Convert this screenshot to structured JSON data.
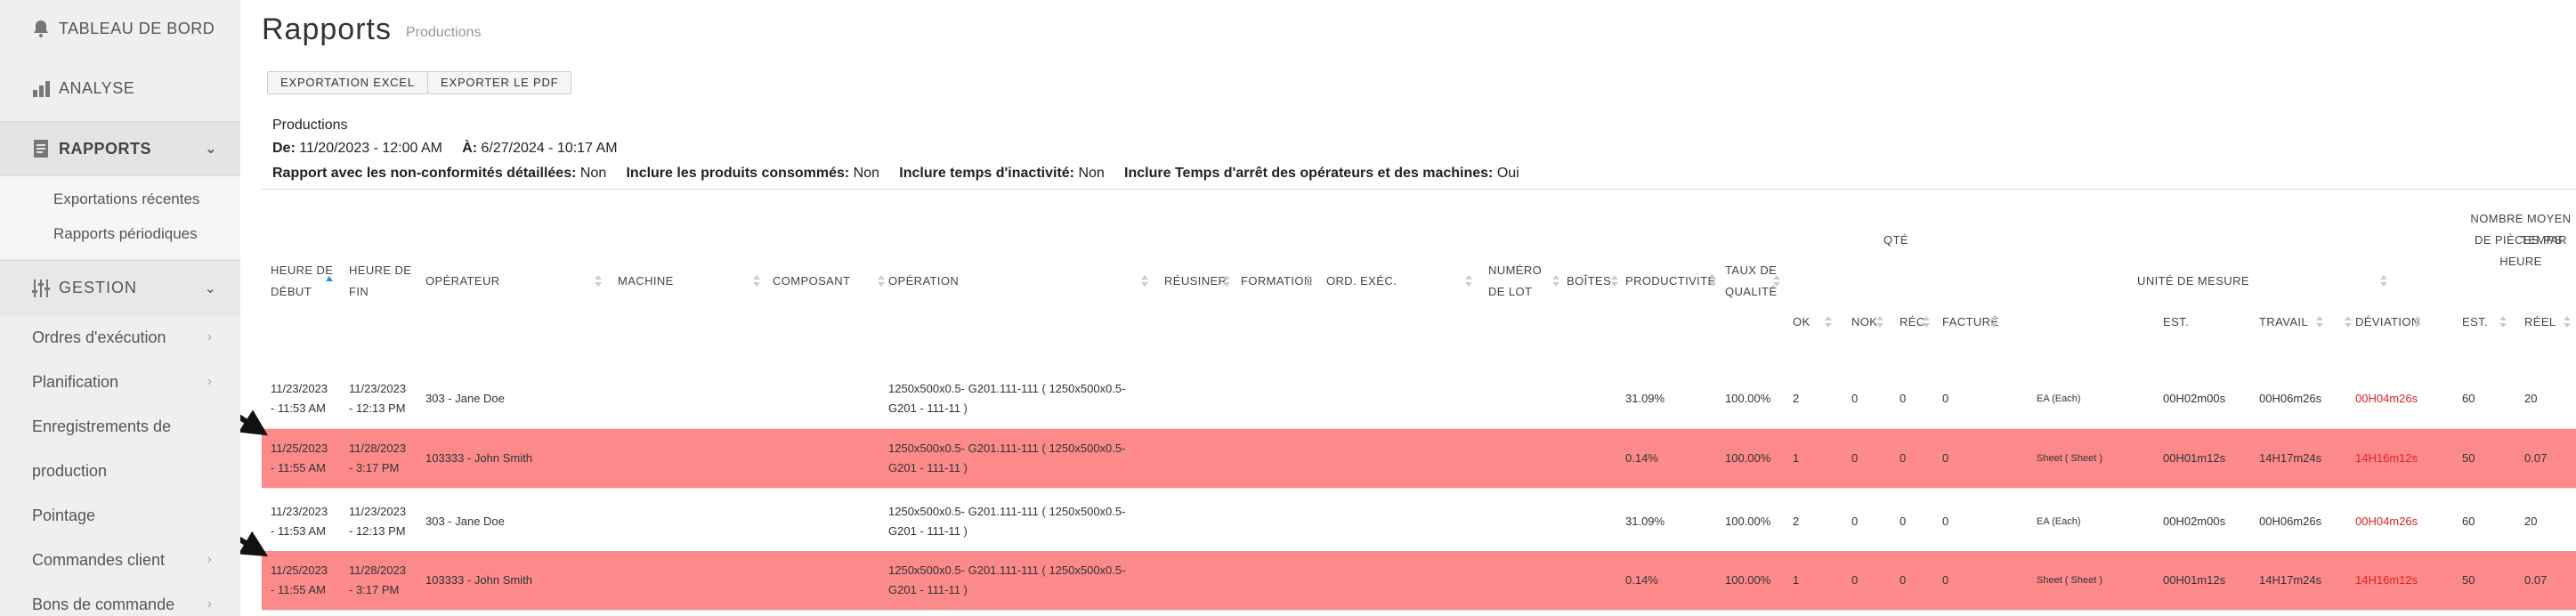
{
  "sidebar": {
    "dashboard": "TABLEAU DE BORD",
    "analysis": "ANALYSE",
    "reports": "RAPPORTS",
    "report_items": [
      "Exportations récentes",
      "Rapports périodiques"
    ],
    "management": "GESTION",
    "management_items": [
      "Ordres d'exécution",
      "Planification",
      "Enregistrements de production",
      "Pointage",
      "Commandes client",
      "Bons de commande"
    ]
  },
  "header": {
    "title": "Rapports",
    "subtitle": "Productions",
    "export_excel": "EXPORTATION EXCEL",
    "export_pdf": "EXPORTER LE PDF"
  },
  "report_info": {
    "name": "Productions",
    "from_label": "De:",
    "from_value": "11/20/2023 - 12:00 AM",
    "to_label": "À:",
    "to_value": "6/27/2024 - 10:17 AM",
    "nc_label": "Rapport avec les non-conformités détaillées:",
    "nc_value": "Non",
    "consumed_label": "Inclure les produits consommés:",
    "consumed_value": "Non",
    "idle_label": "Inclure temps d'inactivité:",
    "idle_value": "Non",
    "downtime_label": "Inclure Temps d'arrêt des opérateurs et des machines:",
    "downtime_value": "Oui"
  },
  "table": {
    "headers": {
      "start": "HEURE DE DÉBUT",
      "end": "HEURE DE FIN",
      "operator": "OPÉRATEUR",
      "machine": "MACHINE",
      "component": "COMPOSANT",
      "operation": "OPÉRATION",
      "rework": "RÉUSINER",
      "training": "FORMATION",
      "order": "ORD. EXÉC.",
      "lot": "NUMÉRO DE LOT",
      "boxes": "BOÎTES",
      "productivity": "PRODUCTIVITÉ",
      "quality": "TAUX DE QUALITÉ",
      "qty_group": "QTÉ",
      "ok": "OK",
      "nok": "NOK",
      "rec": "RÉC.",
      "billed": "FACTURÉ",
      "unit": "UNITÉ DE MESURE",
      "time_group": "TEMPS",
      "est": "EST.",
      "work": "TRAVAIL",
      "deviation": "DÉVIATION",
      "avg_group": "NOMBRE MOYEN DE PIÈCES PAR HEURE",
      "avg_est": "EST.",
      "avg_real": "RÉEL"
    },
    "rows": [
      {
        "start": "11/23/2023 - 11:53 AM",
        "end": "11/23/2023 - 12:13 PM",
        "operator": "303 - Jane Doe",
        "operation": "1250x500x0.5- G201.111-111 ( 1250x500x0.5-G201 - 111-11 )",
        "productivity": "31.09%",
        "quality": "100.00%",
        "ok": "2",
        "nok": "0",
        "rec": "0",
        "billed": "0",
        "unit": "EA (Each)",
        "est": "00H02m00s",
        "work": "00H06m26s",
        "deviation": "00H04m26s",
        "avg_est": "60",
        "avg_real": "20",
        "nc": false
      },
      {
        "start": "11/25/2023 - 11:55 AM",
        "end": "11/28/2023 - 3:17 PM",
        "operator": "103333 - John Smith",
        "operation": "1250x500x0.5- G201.111-111 ( 1250x500x0.5-G201 - 111-11 )",
        "productivity": "0.14%",
        "quality": "100.00%",
        "ok": "1",
        "nok": "0",
        "rec": "0",
        "billed": "0",
        "unit": "Sheet ( Sheet )",
        "est": "00H01m12s",
        "work": "14H17m24s",
        "deviation": "14H16m12s",
        "avg_est": "50",
        "avg_real": "0.07",
        "nc": true
      },
      {
        "start": "11/23/2023 - 11:53 AM",
        "end": "11/23/2023 - 12:13 PM",
        "operator": "303 - Jane Doe",
        "operation": "1250x500x0.5- G201.111-111 ( 1250x500x0.5-G201 - 111-11 )",
        "productivity": "31.09%",
        "quality": "100.00%",
        "ok": "2",
        "nok": "0",
        "rec": "0",
        "billed": "0",
        "unit": "EA (Each)",
        "est": "00H02m00s",
        "work": "00H06m26s",
        "deviation": "00H04m26s",
        "avg_est": "60",
        "avg_real": "20",
        "nc": false
      },
      {
        "start": "11/25/2023 - 11:55 AM",
        "end": "11/28/2023 - 3:17 PM",
        "operator": "103333 - John Smith",
        "operation": "1250x500x0.5- G201.111-111 ( 1250x500x0.5-G201 - 111-11 )",
        "productivity": "0.14%",
        "quality": "100.00%",
        "ok": "1",
        "nok": "0",
        "rec": "0",
        "billed": "0",
        "unit": "Sheet ( Sheet )",
        "est": "00H01m12s",
        "work": "14H17m24s",
        "deviation": "14H16m12s",
        "avg_est": "50",
        "avg_real": "0.07",
        "nc": true
      }
    ]
  },
  "colors": {
    "nonconform_row": "#fc8a8a",
    "deviation": "#e02020",
    "sort_active": "#2a8fd8"
  }
}
